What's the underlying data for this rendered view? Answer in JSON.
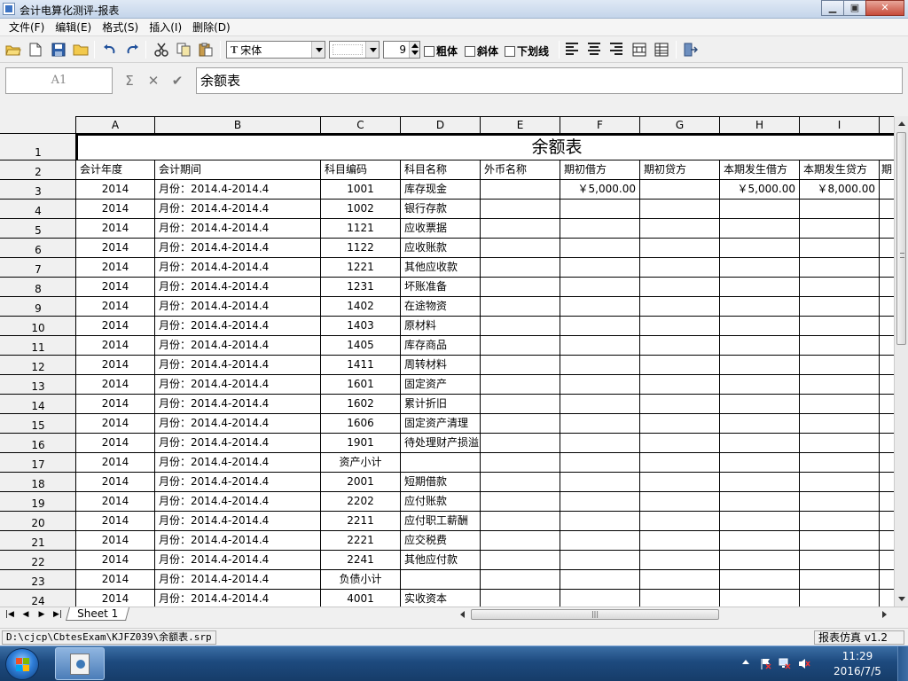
{
  "window": {
    "title": "会计电算化测评-报表",
    "minimize": "▁",
    "maximize": "▣",
    "close": "✕"
  },
  "menu": [
    "文件(F)",
    "编辑(E)",
    "格式(S)",
    "插入(I)",
    "删除(D)"
  ],
  "toolbar": {
    "font_name": "宋体",
    "font_size": "9",
    "bold_label": "粗体",
    "italic_label": "斜体",
    "underline_label": "下划线"
  },
  "formula_bar": {
    "cell_ref": "A1",
    "sum_symbol": "Σ",
    "cancel_symbol": "✕",
    "confirm_symbol": "✔",
    "content": "余额表"
  },
  "sheet": {
    "title": "余额表",
    "columns": [
      "A",
      "B",
      "C",
      "D",
      "E",
      "F",
      "G",
      "H",
      "I"
    ],
    "headers": [
      "会计年度",
      "会计期间",
      "科目编码",
      "科目名称",
      "外币名称",
      "期初借方",
      "期初贷方",
      "本期发生借方",
      "本期发生贷方",
      "期"
    ],
    "rows": [
      {
        "n": "3",
        "year": "2014",
        "period": "月份：2014.4-2014.4",
        "code": "1001",
        "name": "库存现金",
        "f": "￥5,000.00",
        "h": "￥5,000.00",
        "i": "￥8,000.00"
      },
      {
        "n": "4",
        "year": "2014",
        "period": "月份：2014.4-2014.4",
        "code": "1002",
        "name": "银行存款"
      },
      {
        "n": "5",
        "year": "2014",
        "period": "月份：2014.4-2014.4",
        "code": "1121",
        "name": "应收票据"
      },
      {
        "n": "6",
        "year": "2014",
        "period": "月份：2014.4-2014.4",
        "code": "1122",
        "name": "应收账款"
      },
      {
        "n": "7",
        "year": "2014",
        "period": "月份：2014.4-2014.4",
        "code": "1221",
        "name": "其他应收款"
      },
      {
        "n": "8",
        "year": "2014",
        "period": "月份：2014.4-2014.4",
        "code": "1231",
        "name": "坏账准备"
      },
      {
        "n": "9",
        "year": "2014",
        "period": "月份：2014.4-2014.4",
        "code": "1402",
        "name": "在途物资"
      },
      {
        "n": "10",
        "year": "2014",
        "period": "月份：2014.4-2014.4",
        "code": "1403",
        "name": "原材料"
      },
      {
        "n": "11",
        "year": "2014",
        "period": "月份：2014.4-2014.4",
        "code": "1405",
        "name": "库存商品"
      },
      {
        "n": "12",
        "year": "2014",
        "period": "月份：2014.4-2014.4",
        "code": "1411",
        "name": "周转材料"
      },
      {
        "n": "13",
        "year": "2014",
        "period": "月份：2014.4-2014.4",
        "code": "1601",
        "name": "固定资产"
      },
      {
        "n": "14",
        "year": "2014",
        "period": "月份：2014.4-2014.4",
        "code": "1602",
        "name": "累计折旧"
      },
      {
        "n": "15",
        "year": "2014",
        "period": "月份：2014.4-2014.4",
        "code": "1606",
        "name": "固定资产清理"
      },
      {
        "n": "16",
        "year": "2014",
        "period": "月份：2014.4-2014.4",
        "code": "1901",
        "name": "待处理财产损溢"
      },
      {
        "n": "17",
        "year": "2014",
        "period": "月份：2014.4-2014.4",
        "code": "资产小计",
        "name": ""
      },
      {
        "n": "18",
        "year": "2014",
        "period": "月份：2014.4-2014.4",
        "code": "2001",
        "name": "短期借款"
      },
      {
        "n": "19",
        "year": "2014",
        "period": "月份：2014.4-2014.4",
        "code": "2202",
        "name": "应付账款"
      },
      {
        "n": "20",
        "year": "2014",
        "period": "月份：2014.4-2014.4",
        "code": "2211",
        "name": "应付职工薪酬"
      },
      {
        "n": "21",
        "year": "2014",
        "period": "月份：2014.4-2014.4",
        "code": "2221",
        "name": "应交税费"
      },
      {
        "n": "22",
        "year": "2014",
        "period": "月份：2014.4-2014.4",
        "code": "2241",
        "name": "其他应付款"
      },
      {
        "n": "23",
        "year": "2014",
        "period": "月份：2014.4-2014.4",
        "code": "负债小计",
        "name": ""
      },
      {
        "n": "24",
        "year": "2014",
        "period": "月份：2014.4-2014.4",
        "code": "4001",
        "name": "实收资本"
      }
    ]
  },
  "tabs": {
    "sheet_tab": "Sheet 1",
    "nav_first": "|◀",
    "nav_prev": "◀",
    "nav_next": "▶",
    "nav_last": "▶|",
    "hscroll_grip": "|||"
  },
  "status": {
    "path": "D:\\cjcp\\CbtesExam\\KJFZ039\\余额表.srp",
    "version": "报表仿真 v1.2"
  },
  "taskbar": {
    "time": "11:29",
    "date": "2016/7/5"
  },
  "icons": [
    "open-folder-icon",
    "new-document-icon",
    "save-icon",
    "folder-icon",
    "undo-icon",
    "redo-icon",
    "cut-icon",
    "copy-icon",
    "paste-icon",
    "align-left-icon",
    "align-center-icon",
    "align-right-icon",
    "merge-cells-icon",
    "grid-icon",
    "exit-icon",
    "windows-start-icon",
    "flag-icon",
    "network-icon",
    "volume-icon"
  ]
}
